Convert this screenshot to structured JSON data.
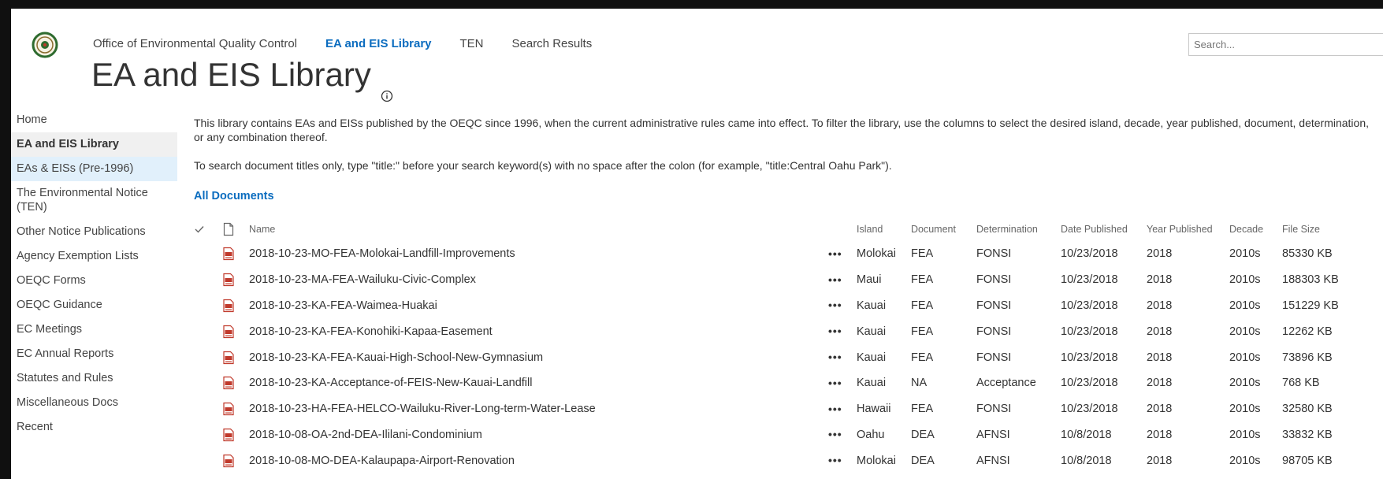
{
  "colors": {
    "accent": "#0b6cbf",
    "selected_bg": "#f0f0f0",
    "hover_bg": "#e1f0fb",
    "pdf": "#c0392b"
  },
  "header": {
    "nav": [
      "Office of Environmental Quality Control",
      "EA and EIS Library",
      "TEN",
      "Search Results"
    ],
    "active_nav": "EA and EIS Library",
    "title": "EA and EIS Library",
    "search_placeholder": "Search..."
  },
  "sidebar": {
    "items": [
      {
        "label": "Home"
      },
      {
        "label": "EA and EIS Library"
      },
      {
        "label": "EAs & EISs (Pre-1996)"
      },
      {
        "label": "The Environmental Notice (TEN)"
      },
      {
        "label": "Other Notice Publications"
      },
      {
        "label": "Agency Exemption Lists"
      },
      {
        "label": "OEQC Forms"
      },
      {
        "label": "OEQC Guidance"
      },
      {
        "label": "EC Meetings"
      },
      {
        "label": "EC Annual Reports"
      },
      {
        "label": "Statutes and Rules"
      },
      {
        "label": "Miscellaneous Docs"
      },
      {
        "label": "Recent"
      }
    ]
  },
  "main": {
    "description": "This library contains EAs and EISs published by the OEQC since 1996, when the current administrative rules came into effect. To filter the library, use the columns to select the desired island, decade, year published, document, determination, or any combination thereof.",
    "search_hint": "To search document titles only, type \"title:\" before your search keyword(s) with no space after the colon (for example, \"title:Central Oahu Park\").",
    "view_label": "All Documents",
    "columns": [
      "Name",
      "Island",
      "Document",
      "Determination",
      "Date Published",
      "Year Published",
      "Decade",
      "File Size"
    ],
    "ellipsis": "•••",
    "rows": [
      {
        "name": "2018-10-23-MO-FEA-Molokai-Landfill-Improvements",
        "island": "Molokai",
        "document": "FEA",
        "determination": "FONSI",
        "date": "10/23/2018",
        "year": "2018",
        "decade": "2010s",
        "size": "85330 KB"
      },
      {
        "name": "2018-10-23-MA-FEA-Wailuku-Civic-Complex",
        "island": "Maui",
        "document": "FEA",
        "determination": "FONSI",
        "date": "10/23/2018",
        "year": "2018",
        "decade": "2010s",
        "size": "188303 KB"
      },
      {
        "name": "2018-10-23-KA-FEA-Waimea-Huakai",
        "island": "Kauai",
        "document": "FEA",
        "determination": "FONSI",
        "date": "10/23/2018",
        "year": "2018",
        "decade": "2010s",
        "size": "151229 KB"
      },
      {
        "name": "2018-10-23-KA-FEA-Konohiki-Kapaa-Easement",
        "island": "Kauai",
        "document": "FEA",
        "determination": "FONSI",
        "date": "10/23/2018",
        "year": "2018",
        "decade": "2010s",
        "size": "12262 KB"
      },
      {
        "name": "2018-10-23-KA-FEA-Kauai-High-School-New-Gymnasium",
        "island": "Kauai",
        "document": "FEA",
        "determination": "FONSI",
        "date": "10/23/2018",
        "year": "2018",
        "decade": "2010s",
        "size": "73896 KB"
      },
      {
        "name": "2018-10-23-KA-Acceptance-of-FEIS-New-Kauai-Landfill",
        "island": "Kauai",
        "document": "NA",
        "determination": "Acceptance",
        "date": "10/23/2018",
        "year": "2018",
        "decade": "2010s",
        "size": "768 KB"
      },
      {
        "name": "2018-10-23-HA-FEA-HELCO-Wailuku-River-Long-term-Water-Lease",
        "island": "Hawaii",
        "document": "FEA",
        "determination": "FONSI",
        "date": "10/23/2018",
        "year": "2018",
        "decade": "2010s",
        "size": "32580 KB"
      },
      {
        "name": "2018-10-08-OA-2nd-DEA-Ililani-Condominium",
        "island": "Oahu",
        "document": "DEA",
        "determination": "AFNSI",
        "date": "10/8/2018",
        "year": "2018",
        "decade": "2010s",
        "size": "33832 KB"
      },
      {
        "name": "2018-10-08-MO-DEA-Kalaupapa-Airport-Renovation",
        "island": "Molokai",
        "document": "DEA",
        "determination": "AFNSI",
        "date": "10/8/2018",
        "year": "2018",
        "decade": "2010s",
        "size": "98705 KB"
      }
    ]
  }
}
